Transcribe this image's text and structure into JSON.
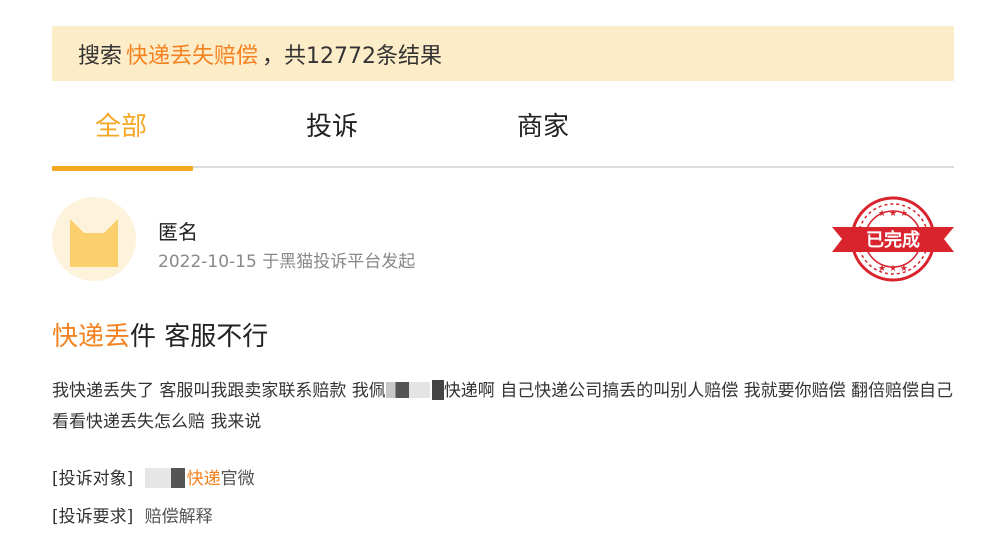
{
  "search": {
    "prefix": "搜索",
    "keyword": "快递丢失赔偿",
    "suffix": "，共12772条结果"
  },
  "tabs": [
    {
      "label": "全部",
      "active": true
    },
    {
      "label": "投诉",
      "active": false
    },
    {
      "label": "商家",
      "active": false
    }
  ],
  "post": {
    "user": "匿名",
    "meta": "2022-10-15 于黑猫投诉平台发起",
    "status_stamp": "已完成",
    "title_highlight": "快递丢",
    "title_rest": "件 客服不行",
    "body_part1": "我快递丢失了 客服叫我跟卖家联系赔款 我佩",
    "body_part2": "快递啊 自己快递公司搞丢的叫别人赔偿 我就要你赔偿 翻倍赔偿自己看看快递丢失怎么赔 我来说",
    "target_label": "[投诉对象]",
    "target_highlight": "快递",
    "target_rest": "官微",
    "demand_label": "[投诉要求]",
    "demand_value": "赔偿解释"
  },
  "colors": {
    "accent": "#f5a623",
    "highlight": "#f58220",
    "banner_bg": "#fdecc8",
    "stamp_red": "#d9232d"
  }
}
